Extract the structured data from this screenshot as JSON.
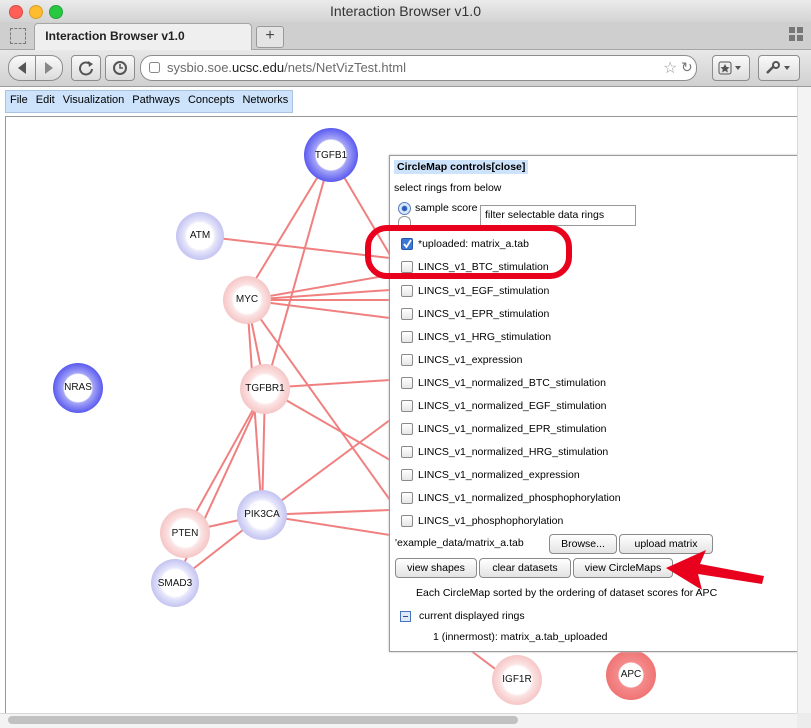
{
  "window": {
    "title": "Interaction Browser v1.0"
  },
  "tab": {
    "label": "Interaction Browser v1.0",
    "new_tab": "+"
  },
  "toolbar": {
    "url_prefix": "sysbio.soe.",
    "url_domain": "ucsc.edu",
    "url_path": "/nets/NetVizTest.html"
  },
  "menu": [
    "File",
    "Edit",
    "Visualization",
    "Pathways",
    "Concepts",
    "Networks"
  ],
  "nodes": {
    "TGFB1": "TGFB1",
    "ATM": "ATM",
    "MYC": "MYC",
    "NRAS": "NRAS",
    "TGFBR1": "TGFBR1",
    "PIK3CA": "PIK3CA",
    "PTEN": "PTEN",
    "SMAD3": "SMAD3",
    "IGF1R": "IGF1R",
    "APC": "APC"
  },
  "panel": {
    "title": "CircleMap controls[close]",
    "select_rings": "select rings from below",
    "sample_score": "sample score",
    "filter_placeholder": "filter selectable data rings",
    "rings": [
      {
        "label": "*uploaded: matrix_a.tab",
        "checked": true
      },
      {
        "label": "LINCS_v1_BTC_stimulation",
        "checked": false
      },
      {
        "label": "LINCS_v1_EGF_stimulation",
        "checked": false
      },
      {
        "label": "LINCS_v1_EPR_stimulation",
        "checked": false
      },
      {
        "label": "LINCS_v1_HRG_stimulation",
        "checked": false
      },
      {
        "label": "LINCS_v1_expression",
        "checked": false
      },
      {
        "label": "LINCS_v1_normalized_BTC_stimulation",
        "checked": false
      },
      {
        "label": "LINCS_v1_normalized_EGF_stimulation",
        "checked": false
      },
      {
        "label": "LINCS_v1_normalized_EPR_stimulation",
        "checked": false
      },
      {
        "label": "LINCS_v1_normalized_HRG_stimulation",
        "checked": false
      },
      {
        "label": "LINCS_v1_normalized_expression",
        "checked": false
      },
      {
        "label": "LINCS_v1_normalized_phosphophorylation",
        "checked": false
      },
      {
        "label": "LINCS_v1_phosphophorylation",
        "checked": false
      }
    ],
    "file_value": "'example_data/matrix_a.tab",
    "browse": "Browse...",
    "upload": "upload matrix",
    "view_shapes": "view shapes",
    "clear_datasets": "clear datasets",
    "view_circlemaps": "view CircleMaps",
    "sorted_note": "Each CircleMap sorted by the ordering of dataset scores for APC",
    "current_rings": "current displayed rings",
    "ring_entry": "1 (innermost): matrix_a.tab_uploaded"
  },
  "colors": {
    "edge": "#f08080",
    "highlight": "#e8001c",
    "menubar": "#cde3fb",
    "blue_ring": "#5a5af0"
  }
}
